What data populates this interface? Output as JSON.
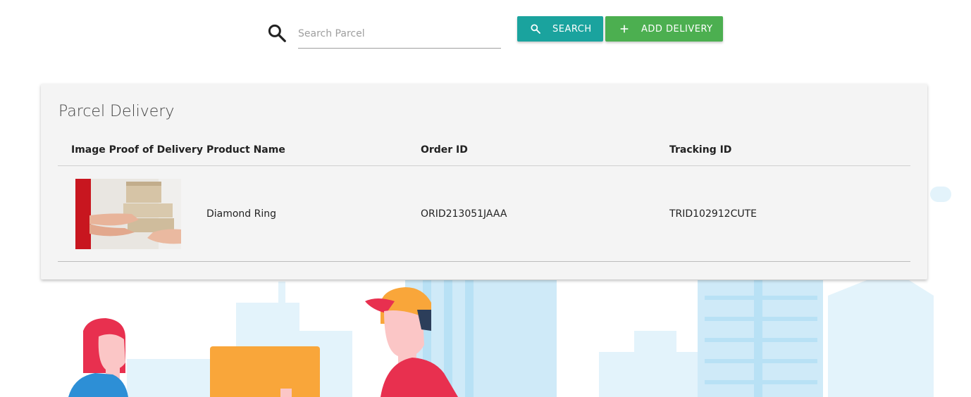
{
  "search": {
    "placeholder": "Search Parcel",
    "value": "",
    "icon": "search-icon"
  },
  "toolbar": {
    "search_label": "SEARCH",
    "search_icon": "search-icon",
    "add_label": "ADD DELIVERY",
    "add_icon": "plus-icon"
  },
  "colors": {
    "search_button": "#1aa39e",
    "add_button": "#4caf50",
    "card_background": "#f4f4f4"
  },
  "card": {
    "title": "Parcel Delivery",
    "columns": [
      "Image Proof of Delivery",
      "Product Name",
      "Order ID",
      "Tracking ID"
    ],
    "rows": [
      {
        "image": "delivery-proof-photo",
        "product_name": "Diamond Ring",
        "order_id": "ORID213051JAAA",
        "tracking_id": "TRID102912CUTE"
      }
    ]
  }
}
